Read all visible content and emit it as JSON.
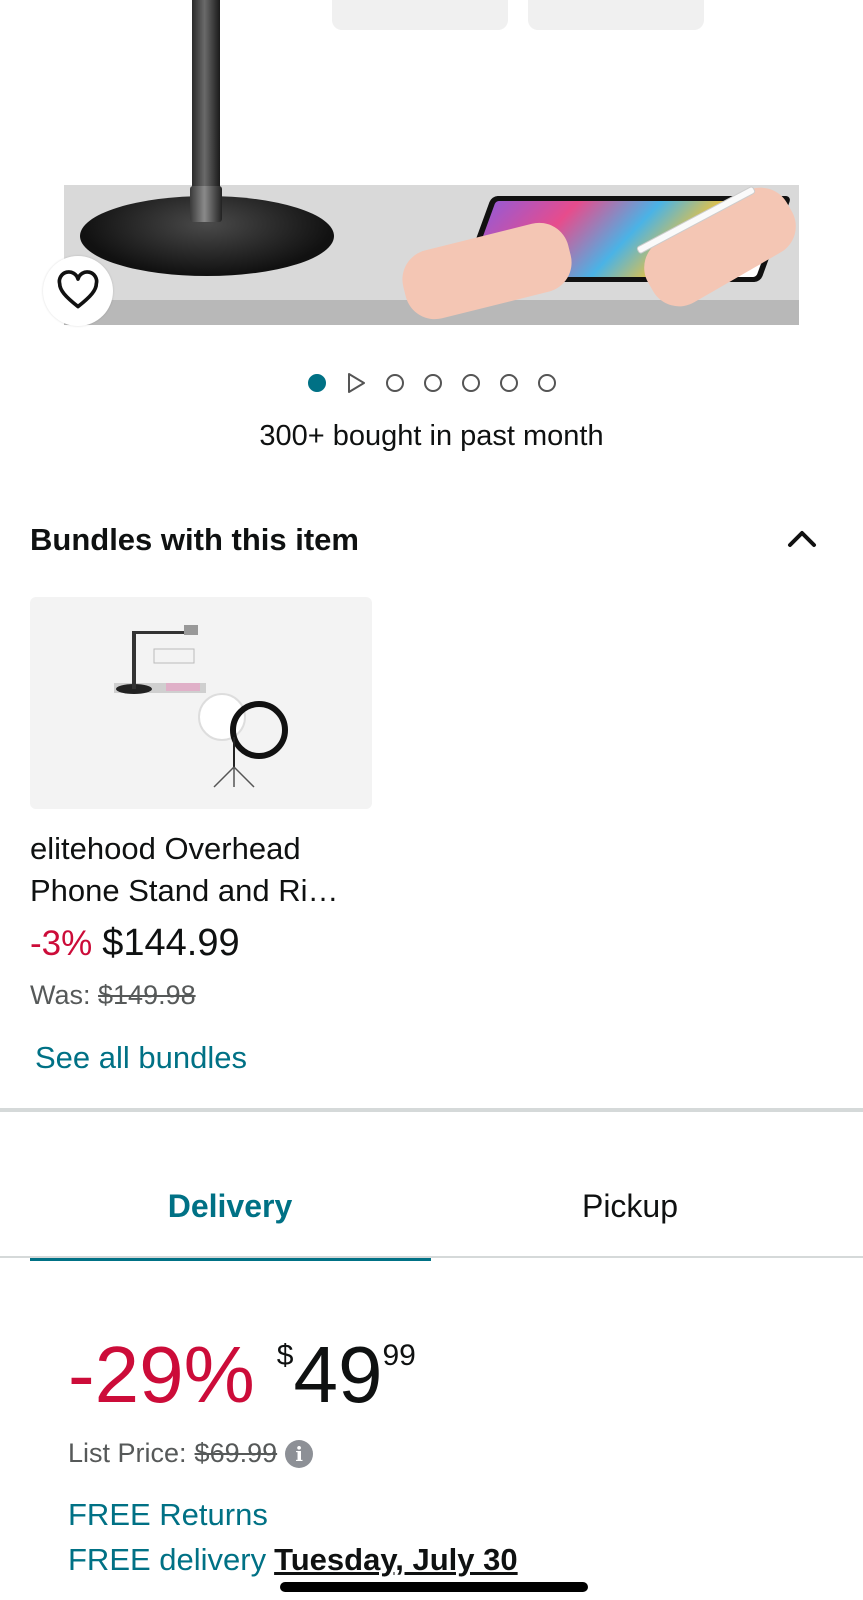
{
  "gallery": {
    "bought_text": "300+ bought in past month",
    "dot_count": 7,
    "active_dot": 0,
    "accent": "#007185"
  },
  "bundles": {
    "title": "Bundles with this item",
    "item": {
      "name": "elitehood Overhead Phone Stand and Ri…",
      "discount": "-3%",
      "price": "$144.99",
      "was_label": "Was:",
      "was_price": "$149.98"
    },
    "see_all": "See all bundles"
  },
  "tabs": {
    "delivery": "Delivery",
    "pickup": "Pickup",
    "active": "Delivery"
  },
  "pricing": {
    "discount": "-29%",
    "currency": "$",
    "whole": "49",
    "fraction": "99",
    "list_label": "List Price:",
    "list_price": "$69.99"
  },
  "shipping": {
    "returns": "FREE Returns",
    "delivery_label": "FREE delivery",
    "delivery_date": "Tuesday, July 30"
  },
  "colors": {
    "link": "#007185",
    "deal": "#cc0c39",
    "text": "#0f1111",
    "muted": "#565959"
  }
}
